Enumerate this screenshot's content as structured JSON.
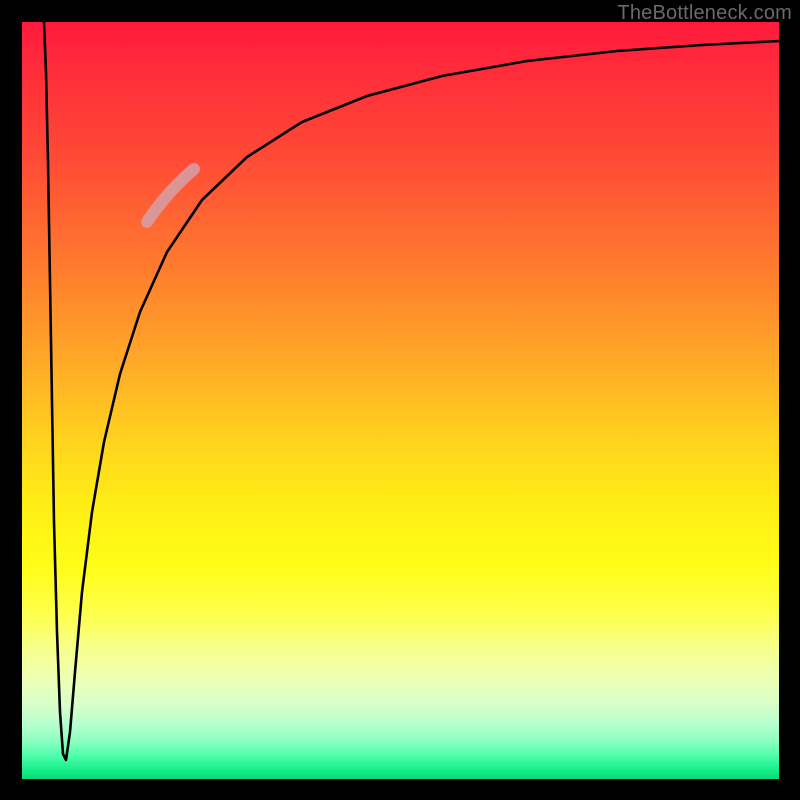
{
  "watermark": "TheBottleneck.com",
  "chart_data": {
    "type": "line",
    "title": "",
    "xlabel": "",
    "ylabel": "",
    "xlim": [
      0,
      100
    ],
    "ylim": [
      0,
      100
    ],
    "x": [
      2.9,
      3.1,
      3.3,
      3.6,
      3.9,
      4.2,
      4.6,
      5.0,
      5.5,
      6.0,
      6.6,
      7.3,
      8.0,
      9.0,
      10.0,
      11.5,
      13.5,
      16.0,
      20.0,
      25.0,
      32.0,
      40.0,
      50.0,
      62.0,
      75.0,
      88.0,
      100.0
    ],
    "series": [
      {
        "name": "curve-main",
        "values": [
          100,
          82,
          62,
          42,
          24,
          10,
          3,
          3,
          9,
          17,
          25,
          33,
          40,
          48,
          54,
          61,
          68,
          74,
          80,
          85,
          89,
          92,
          94,
          95.5,
          96.5,
          97,
          97.4
        ]
      }
    ],
    "highlight_segment": {
      "x_range": [
        16.5,
        22.5
      ],
      "note": "thick light-pink emphasis on curve"
    },
    "background": "vertical rainbow gradient (red top → green bottom)"
  }
}
